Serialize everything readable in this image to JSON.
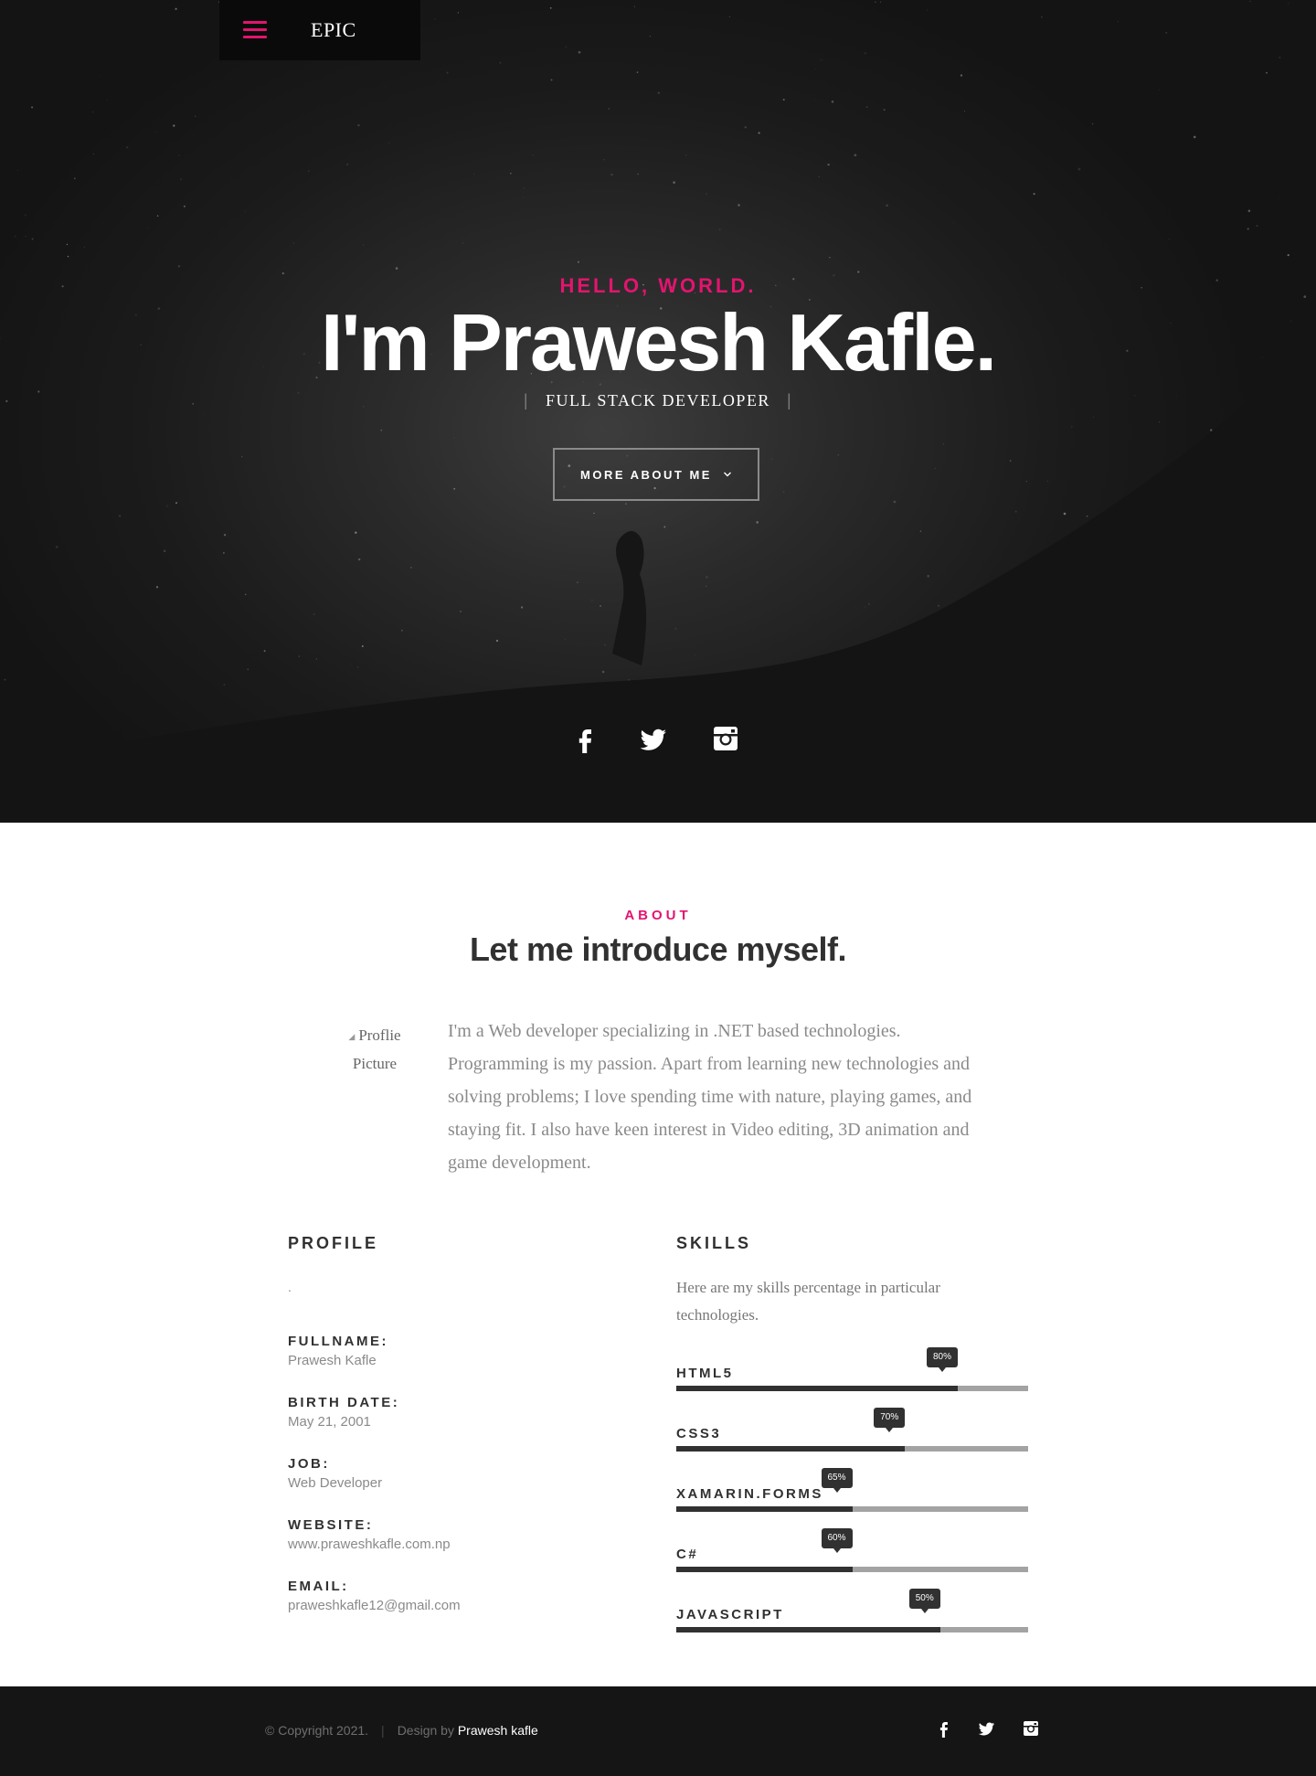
{
  "nav": {
    "logo": "EPIC",
    "menu_icon": "hamburger-menu-icon"
  },
  "hero": {
    "greeting": "HELLO, WORLD.",
    "name": "I'm Prawesh Kafle.",
    "role": "FULL STACK DEVELOPER",
    "role_divider": "|",
    "button_label": "MORE ABOUT ME",
    "button_icon": "chevron-down-icon",
    "social": [
      "facebook-icon",
      "twitter-icon",
      "instagram-icon"
    ]
  },
  "about": {
    "kicker": "ABOUT",
    "title": "Let me introduce myself.",
    "profile_pic_alt": "Proflie Picture",
    "text": "I'm a Web developer specializing in .NET based technologies. Programming is my passion. Apart from learning new technologies and solving problems; I love spending time with nature, playing games, and staying fit. I also have keen interest in Video editing, 3D animation and game development."
  },
  "profile": {
    "heading": "PROFILE",
    "intro": ".",
    "items": [
      {
        "label": "FULLNAME:",
        "value": "Prawesh Kafle"
      },
      {
        "label": "BIRTH DATE:",
        "value": "May 21, 2001"
      },
      {
        "label": "JOB:",
        "value": "Web Developer"
      },
      {
        "label": "WEBSITE:",
        "value": "www.praweshkafle.com.np"
      },
      {
        "label": "EMAIL:",
        "value": "praweshkafle12@gmail.com"
      }
    ]
  },
  "skills": {
    "heading": "SKILLS",
    "intro": "Here are my skills percentage in particular technologies.",
    "items": [
      {
        "name": "HTML5",
        "percent_label": "80%",
        "level": 0.8
      },
      {
        "name": "CSS3",
        "percent_label": "70%",
        "level": 0.65
      },
      {
        "name": "XAMARIN.FORMS",
        "percent_label": "65%",
        "level": 0.5
      },
      {
        "name": "C#",
        "percent_label": "60%",
        "level": 0.5
      },
      {
        "name": "JAVASCRIPT",
        "percent_label": "50%",
        "level": 0.75
      }
    ]
  },
  "footer": {
    "copyright": "© Copyright 2021.",
    "divider": "|",
    "design_by": "Design by",
    "author": "Prawesh kafle",
    "social": [
      "facebook-icon",
      "twitter-icon",
      "instagram-icon"
    ]
  },
  "colors": {
    "accent": "#e3146f",
    "dark": "#313131",
    "footer_bg": "#151515"
  }
}
